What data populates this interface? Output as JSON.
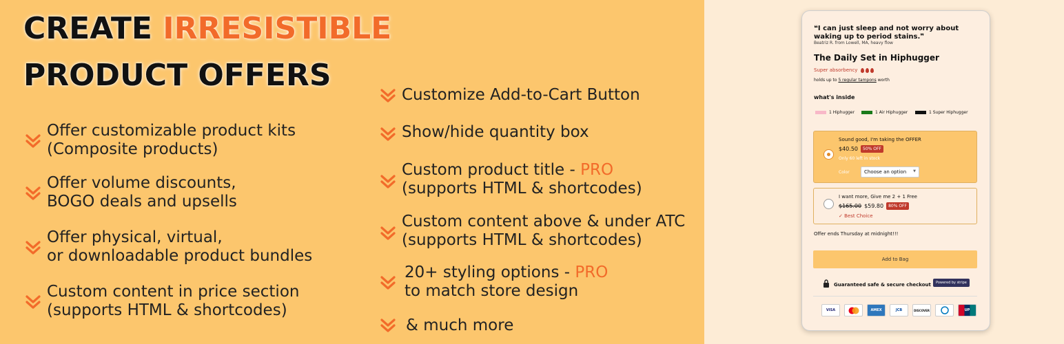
{
  "headline": {
    "line1_a": "CREATE ",
    "line1_b": "IRRESISTIBLE",
    "line2": "PRODUCT OFFERS"
  },
  "features_left": [
    {
      "line1": "Offer customizable product kits",
      "line2": "(Composite products)"
    },
    {
      "line1": "Offer volume discounts,",
      "line2": "BOGO deals and upsells"
    },
    {
      "line1": "Offer physical, virtual,",
      "line2": "or downloadable product bundles"
    },
    {
      "line1": "Custom content in price section",
      "line2": "(supports HTML & shortcodes)"
    }
  ],
  "features_right": [
    {
      "line1": "Customize Add-to-Cart Button"
    },
    {
      "line1": "Show/hide quantity box"
    },
    {
      "line1": "Custom product title - ",
      "pro": "PRO",
      "line2": "(supports HTML & shortcodes)"
    },
    {
      "line1": "Custom content above & under ATC",
      "line2": "(supports HTML & shortcodes)"
    },
    {
      "line1": "20+ styling options - ",
      "pro": "PRO",
      "line2": "to match store design"
    },
    {
      "line1": "& much more"
    }
  ],
  "card": {
    "quote": "❝I can just sleep and not worry about waking up to period stains.❞",
    "reviewer": "Beatriz R. from Lowell, MA, heavy flow",
    "product_title": "The Daily Set in Hiphugger",
    "absorbency": "Super absorbency",
    "holds_a": "holds up to ",
    "holds_b": "5 regular tampons",
    "holds_c": " worth",
    "inside_label": "what's inside",
    "swatches": [
      {
        "label": "1 Hiphugger",
        "color": "#f8b8c8"
      },
      {
        "label": "1 Air Hiphugger",
        "color": "#1a7a1a"
      },
      {
        "label": "1 Super Hiphugger",
        "color": "#111111"
      }
    ],
    "offer1": {
      "title": "Sound good, I'm taking the OFFER",
      "price": "$40.50",
      "badge": "50% OFF",
      "stock": "Only 60 left in stock",
      "color_label": "Color",
      "select_value": "Choose an option"
    },
    "offer2": {
      "title": "I want more, Give me 2 + 1 Free",
      "old_price": "$165.00",
      "price": "$59.80",
      "badge": "80% OFF",
      "best": "✓ Best Choice"
    },
    "ends": "Offer ends Thursday at midnight!!!",
    "atc": "Add to Bag",
    "secure": "Guaranteed safe & secure checkout",
    "stripe": "Powered by stripe",
    "payments": [
      "VISA",
      "MC",
      "AMEX",
      "JCB",
      "DISCOVER",
      "DC",
      "UP"
    ]
  },
  "colors": {
    "left_bg": "#fcc66d",
    "right_bg": "#fdecd6",
    "accent": "#f26b2a",
    "sale": "#c0392b"
  }
}
